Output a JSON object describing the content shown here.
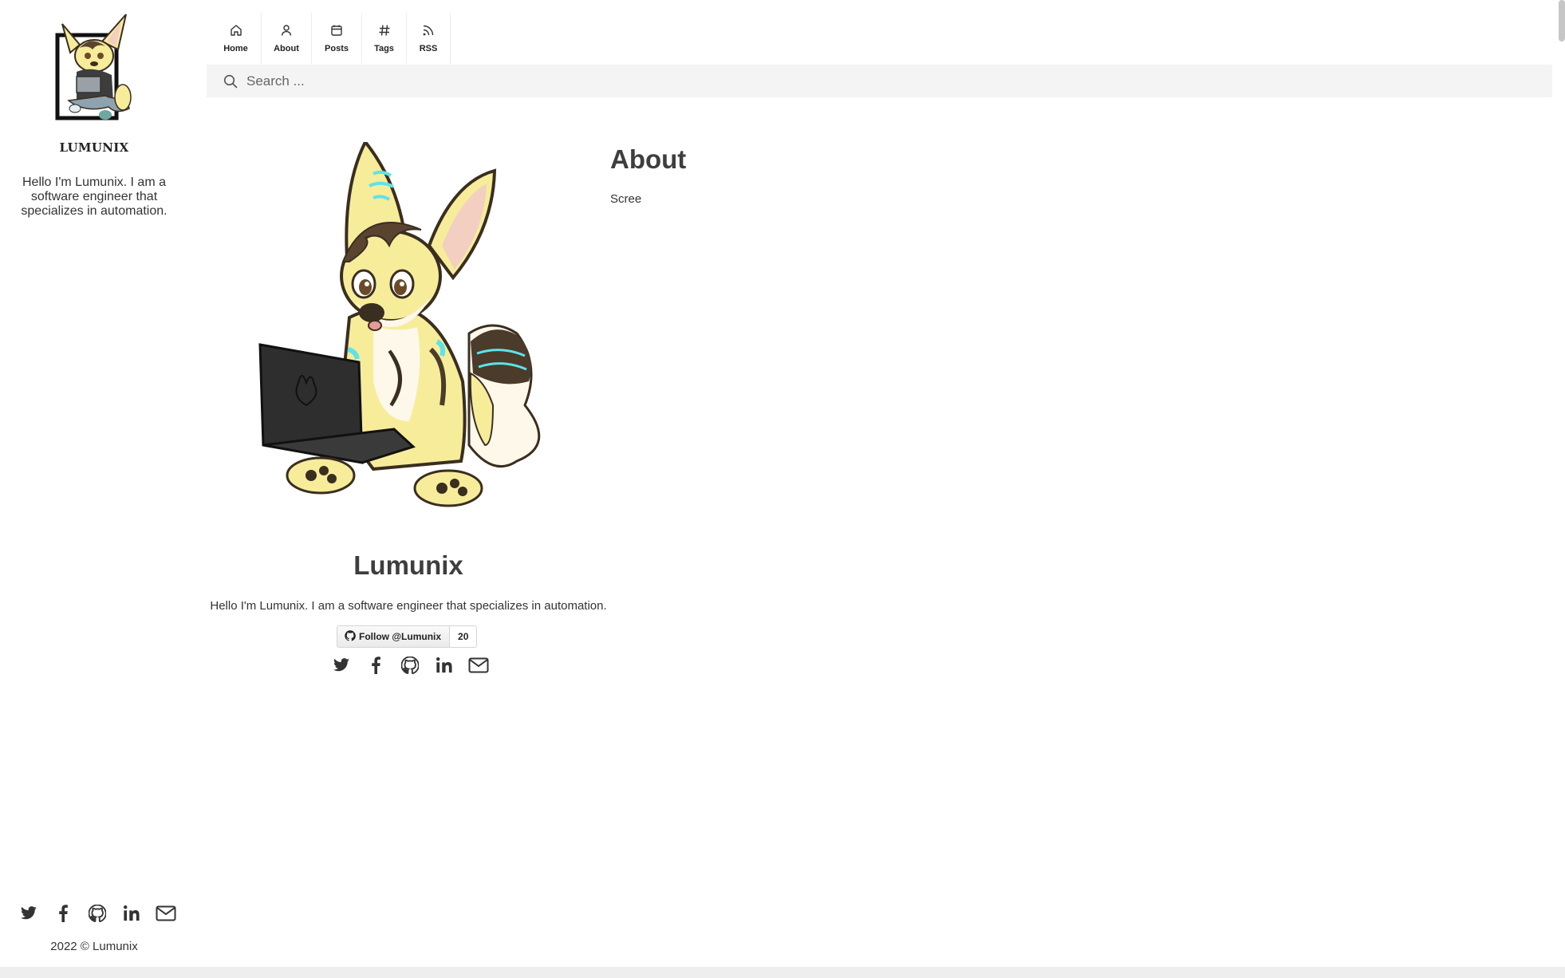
{
  "sidebar": {
    "site_name": "LUMUNIX",
    "bio": "Hello I'm Lumunix. I am a software engineer that specializes in automation.",
    "social": [
      "twitter-icon",
      "facebook-icon",
      "github-icon",
      "linkedin-icon",
      "mail-icon"
    ],
    "footer": "2022 © Lumunix"
  },
  "nav": {
    "items": [
      {
        "label": "Home",
        "icon": "home-icon"
      },
      {
        "label": "About",
        "icon": "user-icon"
      },
      {
        "label": "Posts",
        "icon": "calendar-icon"
      },
      {
        "label": "Tags",
        "icon": "hash-icon"
      },
      {
        "label": "RSS",
        "icon": "rss-icon"
      }
    ]
  },
  "search": {
    "placeholder": "Search ...",
    "value": ""
  },
  "profile": {
    "name": "Lumunix",
    "bio": "Hello I'm Lumunix. I am a software engineer that specializes in automation.",
    "github_follow_label": "Follow @Lumunix",
    "github_follow_count": "20",
    "social": [
      "twitter-icon",
      "facebook-icon",
      "github-icon",
      "linkedin-icon",
      "mail-icon"
    ]
  },
  "about": {
    "title": "About",
    "text": "Scree"
  },
  "colors": {
    "text": "#333333",
    "heading": "#3e3e3e",
    "search_bg": "#f4f4f4",
    "character_yellow": "#f7ec9a",
    "character_cyan": "#5ee3e8",
    "character_brown": "#4a3b2a"
  }
}
